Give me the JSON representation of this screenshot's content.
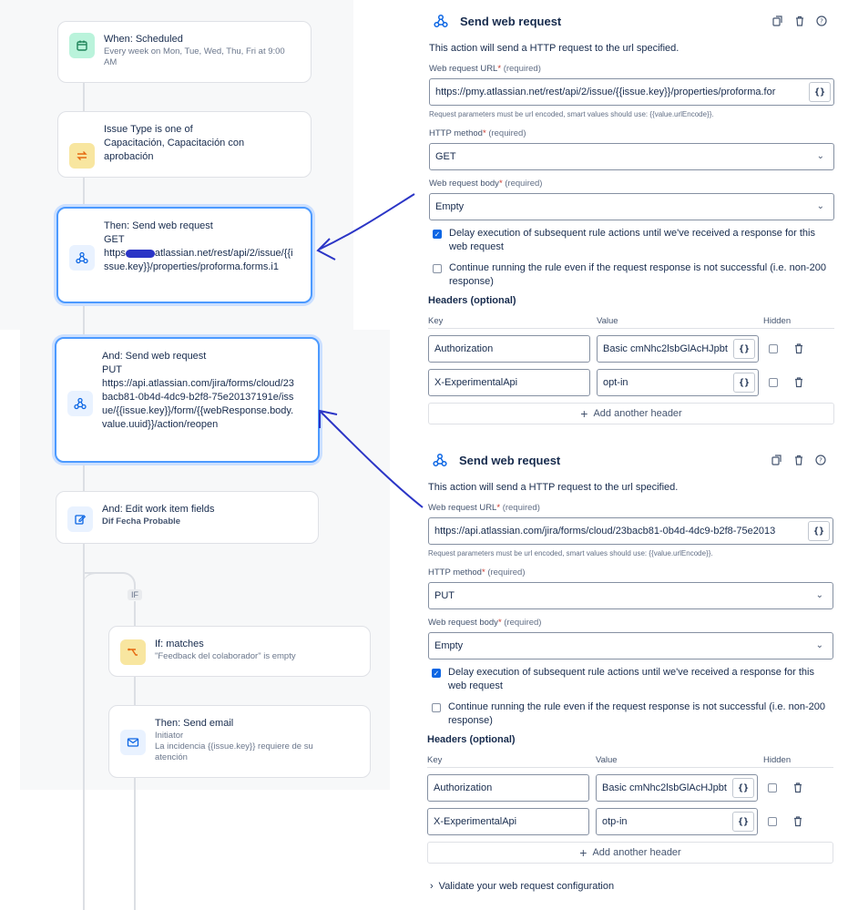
{
  "rule": {
    "trigger": {
      "title": "When: Scheduled",
      "subtitle": "Every week on Mon, Tue, Wed, Thu, Fri at 9:00 AM"
    },
    "condition": {
      "title": "Issue Type is one of",
      "detail": "Capacitación, Capacitación con aprobación"
    },
    "action1": {
      "title": "Then: Send web request",
      "method": "GET",
      "url_prefix": "https",
      "url_rest": "atlassian.net/rest/api/2/issue/{{issue.key}}/properties/proforma.forms.i1"
    },
    "action2": {
      "title": "And: Send web request",
      "method": "PUT",
      "url": "https://api.atlassian.com/jira/forms/cloud/23bacb81-0b4d-4dc9-b2f8-75e20137191e/issue/{{issue.key}}/form/{{webResponse.body.value.uuid}}/action/reopen"
    },
    "action3": {
      "title": "And: Edit work item fields",
      "detail": "Dif Fecha Probable"
    },
    "if_badge": "IF",
    "if_cond": {
      "title": "If: matches",
      "detail": "\"Feedback del colaborador\" is empty"
    },
    "email": {
      "title": "Then: Send email",
      "line1": "Initiator",
      "line2": "La incidencia {{issue.key}} requiere de su atención"
    }
  },
  "colors": {
    "accent": "#0c66e4",
    "selected_border": "#4c9aff",
    "arrow": "#2b35c6"
  },
  "panel1": {
    "title": "Send web request",
    "description": "This action will send a HTTP request to the url specified.",
    "url_label": "Web request URL",
    "required": "(required)",
    "star": "*",
    "url_value": "https://pmy.atlassian.net/rest/api/2/issue/{{issue.key}}/properties/proforma.for",
    "url_hint": "Request parameters must be url encoded, smart values should use: {{value.urlEncode}}.",
    "method_label": "HTTP method",
    "method_value": "GET",
    "body_label": "Web request body",
    "body_value": "Empty",
    "delay_label": "Delay execution of subsequent rule actions until we've received a response for this web request",
    "continue_label": "Continue running the rule even if the request response is not successful (i.e. non-200 response)",
    "headers_title": "Headers (optional)",
    "col_key": "Key",
    "col_value": "Value",
    "col_hidden": "Hidden",
    "headers": [
      {
        "key": "Authorization",
        "value": "Basic cmNhc2lsbGlAcHJpbt"
      },
      {
        "key": "X-ExperimentalApi",
        "value": "opt-in"
      }
    ],
    "add_header": "Add another header"
  },
  "panel2": {
    "title": "Send web request",
    "description": "This action will send a HTTP request to the url specified.",
    "url_label": "Web request URL",
    "required": "(required)",
    "star": "*",
    "url_value": "https://api.atlassian.com/jira/forms/cloud/23bacb81-0b4d-4dc9-b2f8-75e2013",
    "url_hint": "Request parameters must be url encoded, smart values should use: {{value.urlEncode}}.",
    "method_label": "HTTP method",
    "method_value": "PUT",
    "body_label": "Web request body",
    "body_value": "Empty",
    "delay_label": "Delay execution of subsequent rule actions until we've received a response for this web request",
    "continue_label": "Continue running the rule even if the request response is not successful (i.e. non-200 response)",
    "headers_title": "Headers (optional)",
    "col_key": "Key",
    "col_value": "Value",
    "col_hidden": "Hidden",
    "headers": [
      {
        "key": "Authorization",
        "value": "Basic cmNhc2lsbGlAcHJpbt"
      },
      {
        "key": "X-ExperimentalApi",
        "value": "otp-in"
      }
    ],
    "add_header": "Add another header",
    "validate": "Validate your web request configuration"
  },
  "smart_value_btn": "{}"
}
